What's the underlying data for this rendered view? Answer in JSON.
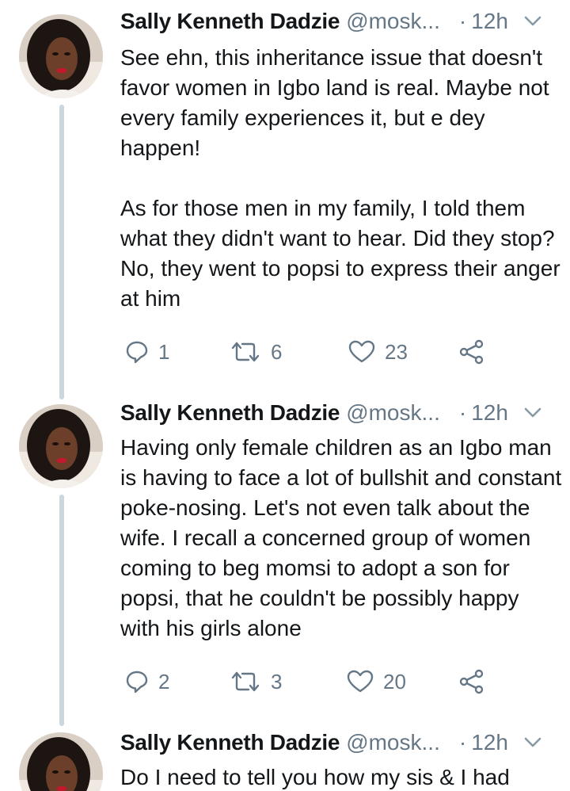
{
  "colors": {
    "thread_line": "#ccd6dd",
    "text": "#14171a",
    "muted": "#657786"
  },
  "tweets": [
    {
      "author_name": "Sally Kenneth Dadzie",
      "author_handle": "@mosk...",
      "separator": "·",
      "time": "12h",
      "text": "See ehn, this inheritance issue that doesn't favor women in Igbo land is real. Maybe not every family experiences it, but e dey happen!\n\nAs for those men in my family, I told them what they didn't want to hear. Did they stop? No, they went to popsi to express their anger at him",
      "replies": "1",
      "retweets": "6",
      "likes": "23",
      "icons": [
        "reply-icon",
        "retweet-icon",
        "like-icon",
        "share-icon",
        "chevron-down-icon"
      ]
    },
    {
      "author_name": "Sally Kenneth Dadzie",
      "author_handle": "@mosk...",
      "separator": "·",
      "time": "12h",
      "text": "Having only female children as an Igbo man is having to face a lot of bullshit and constant poke-nosing. Let's not even talk about the wife. I recall a concerned group of women coming to beg momsi to adopt a son for popsi, that he couldn't be possibly happy with his girls alone",
      "replies": "2",
      "retweets": "3",
      "likes": "20",
      "icons": [
        "reply-icon",
        "retweet-icon",
        "like-icon",
        "share-icon",
        "chevron-down-icon"
      ]
    },
    {
      "author_name": "Sally Kenneth Dadzie",
      "author_handle": "@mosk...",
      "separator": "·",
      "time": "12h",
      "text": "Do I need to tell you how my sis & I had",
      "icons": [
        "chevron-down-icon"
      ]
    }
  ]
}
